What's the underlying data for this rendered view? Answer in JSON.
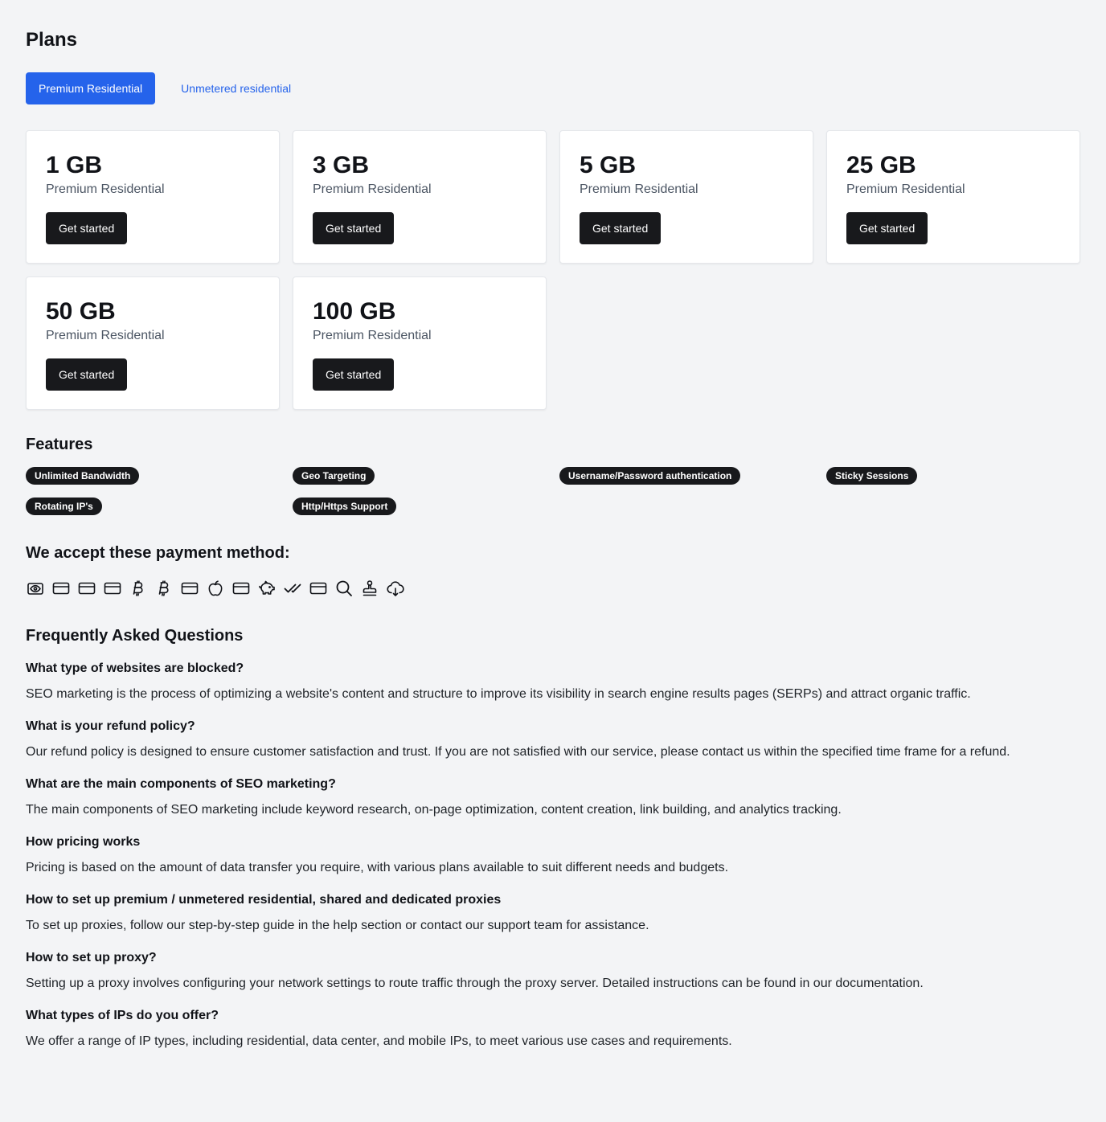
{
  "page": {
    "title": "Plans"
  },
  "tabs": [
    {
      "label": "Premium Residential",
      "active": true
    },
    {
      "label": "Unmetered residential",
      "active": false
    }
  ],
  "plans": [
    {
      "size": "1 GB",
      "name": "Premium Residential",
      "cta": "Get started"
    },
    {
      "size": "3 GB",
      "name": "Premium Residential",
      "cta": "Get started"
    },
    {
      "size": "5 GB",
      "name": "Premium Residential",
      "cta": "Get started"
    },
    {
      "size": "25 GB",
      "name": "Premium Residential",
      "cta": "Get started"
    },
    {
      "size": "50 GB",
      "name": "Premium Residential",
      "cta": "Get started"
    },
    {
      "size": "100 GB",
      "name": "Premium Residential",
      "cta": "Get started"
    }
  ],
  "features": {
    "title": "Features",
    "items": [
      "Unlimited Bandwidth",
      "Geo Targeting",
      "Username/Password authentication",
      "Sticky Sessions",
      "Rotating IP's",
      "Http/Https Support"
    ]
  },
  "payment": {
    "title": "We accept these payment method:",
    "icons": [
      "money-eye-icon",
      "credit-card-icon",
      "credit-card-icon",
      "credit-card-icon",
      "bitcoin-icon",
      "bitcoin-icon",
      "credit-card-icon",
      "apple-icon",
      "credit-card-icon",
      "piggy-bank-icon",
      "double-check-icon",
      "credit-card-icon",
      "search-icon",
      "stamp-icon",
      "cloud-icon"
    ]
  },
  "faq": {
    "title": "Frequently Asked Questions",
    "items": [
      {
        "q": "What type of websites are blocked?",
        "a": "SEO marketing is the process of optimizing a website's content and structure to improve its visibility in search engine results pages (SERPs) and attract organic traffic."
      },
      {
        "q": "What is your refund policy?",
        "a": "Our refund policy is designed to ensure customer satisfaction and trust. If you are not satisfied with our service, please contact us within the specified time frame for a refund."
      },
      {
        "q": "What are the main components of SEO marketing?",
        "a": "The main components of SEO marketing include keyword research, on-page optimization, content creation, link building, and analytics tracking."
      },
      {
        "q": "How pricing works",
        "a": "Pricing is based on the amount of data transfer you require, with various plans available to suit different needs and budgets."
      },
      {
        "q": "How to set up premium / unmetered residential, shared and dedicated proxies",
        "a": "To set up proxies, follow our step-by-step guide in the help section or contact our support team for assistance."
      },
      {
        "q": "How to set up proxy?",
        "a": "Setting up a proxy involves configuring your network settings to route traffic through the proxy server. Detailed instructions can be found in our documentation."
      },
      {
        "q": "What types of IPs do you offer?",
        "a": "We offer a range of IP types, including residential, data center, and mobile IPs, to meet various use cases and requirements."
      }
    ]
  },
  "colors": {
    "accent": "#2563eb",
    "button_dark": "#18191c",
    "background": "#f3f4f6"
  }
}
